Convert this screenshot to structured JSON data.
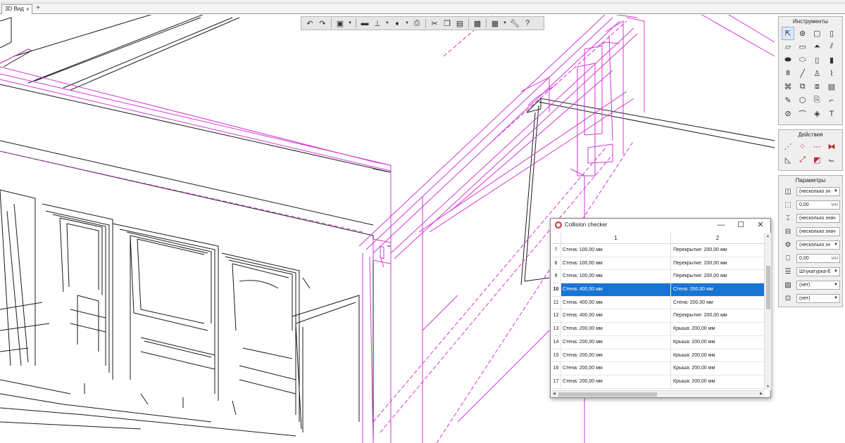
{
  "tabs": [
    {
      "label": "3D Вид",
      "close": "×"
    }
  ],
  "tab_add": "+",
  "toolbar": {
    "buttons": [
      "undo-icon",
      "redo-icon",
      "view-cube-icon",
      "folder-icon",
      "layers-icon",
      "export-icon",
      "print-icon",
      "cut-icon",
      "copy-icon",
      "paste-icon",
      "render-icon",
      "grid-icon",
      "settings-icon",
      "help-icon"
    ]
  },
  "tools_panel": {
    "title": "Инструменты",
    "tools": [
      "select-icon",
      "selection-set-icon",
      "window-icon",
      "column-icon",
      "slab-icon",
      "beam-icon",
      "roof-icon",
      "railing-icon",
      "pipe-icon",
      "plate-icon",
      "door-icon",
      "pillar-icon",
      "truss-icon",
      "line-icon",
      "person-icon",
      "stair-icon",
      "structure-icon",
      "object-icon",
      "furniture-icon",
      "fixture-icon",
      "pencil-icon",
      "sphere-icon",
      "document-icon",
      "bracket-icon",
      "dimension-icon",
      "arc-icon",
      "shape-icon",
      "text-icon"
    ]
  },
  "actions_panel": {
    "title": "Действия",
    "actions": [
      "offset-icon",
      "array-icon",
      "dashed-icon",
      "mirror-icon",
      "rotate-icon",
      "scale-icon",
      "fill-icon",
      "corner-icon"
    ]
  },
  "params_panel": {
    "title": "Параметры",
    "rows": [
      {
        "icon": "material-icon",
        "value": "(несколько зн",
        "kind": "select"
      },
      {
        "icon": "width-icon",
        "value": "0,00",
        "unit": "мм",
        "kind": "unit"
      },
      {
        "icon": "height-icon",
        "value": "(несколько знач",
        "kind": "text"
      },
      {
        "icon": "thickness-icon",
        "value": "(несколько знач",
        "kind": "text"
      },
      {
        "icon": "style-icon",
        "value": "(несколько зн",
        "kind": "select"
      },
      {
        "icon": "offset-icon",
        "value": "0,00",
        "unit": "мм",
        "kind": "unit"
      },
      {
        "icon": "finish-icon",
        "value": "Штукатурка-Е",
        "kind": "select"
      },
      {
        "icon": "hatch-icon",
        "value": "(нет)",
        "kind": "select"
      },
      {
        "icon": "tag-icon",
        "value": "(нет)",
        "kind": "select"
      }
    ]
  },
  "collision_checker": {
    "title": "Collision checker",
    "controls": {
      "minimize": "—",
      "maximize": "☐",
      "close": "✕"
    },
    "columns": [
      "1",
      "2"
    ],
    "rows": [
      {
        "num": "7",
        "a": "Стена: 100,00 мм",
        "b": "Перекрытие: 200,00 мм"
      },
      {
        "num": "8",
        "a": "Стена: 100,00 мм",
        "b": "Перекрытие: 200,00 мм"
      },
      {
        "num": "9",
        "a": "Стена: 100,00 мм",
        "b": "Перекрытие: 200,00 мм"
      },
      {
        "num": "10",
        "a": "Стена: 400,00 мм",
        "b": "Стена: 200,00 мм",
        "selected": true
      },
      {
        "num": "11",
        "a": "Стена: 400,00 мм",
        "b": "Стена: 200,00 мм"
      },
      {
        "num": "12",
        "a": "Стена: 400,00 мм",
        "b": "Перекрытие: 200,00 мм"
      },
      {
        "num": "13",
        "a": "Стена: 200,00 мм",
        "b": "Крыша: 200,00 мм"
      },
      {
        "num": "14",
        "a": "Стена: 200,00 мм",
        "b": "Крыша: 200,00 мм"
      },
      {
        "num": "15",
        "a": "Стена: 200,00 мм",
        "b": "Крыша: 200,00 мм"
      },
      {
        "num": "16",
        "a": "Стена: 200,00 мм",
        "b": "Крыша: 200,00 мм"
      },
      {
        "num": "17",
        "a": "Стена: 200,00 мм",
        "b": "Крыша: 200,00 мм"
      }
    ]
  },
  "colors": {
    "highlight": "#d636d6",
    "selection": "#1874d4",
    "logo": "#d0303a"
  }
}
